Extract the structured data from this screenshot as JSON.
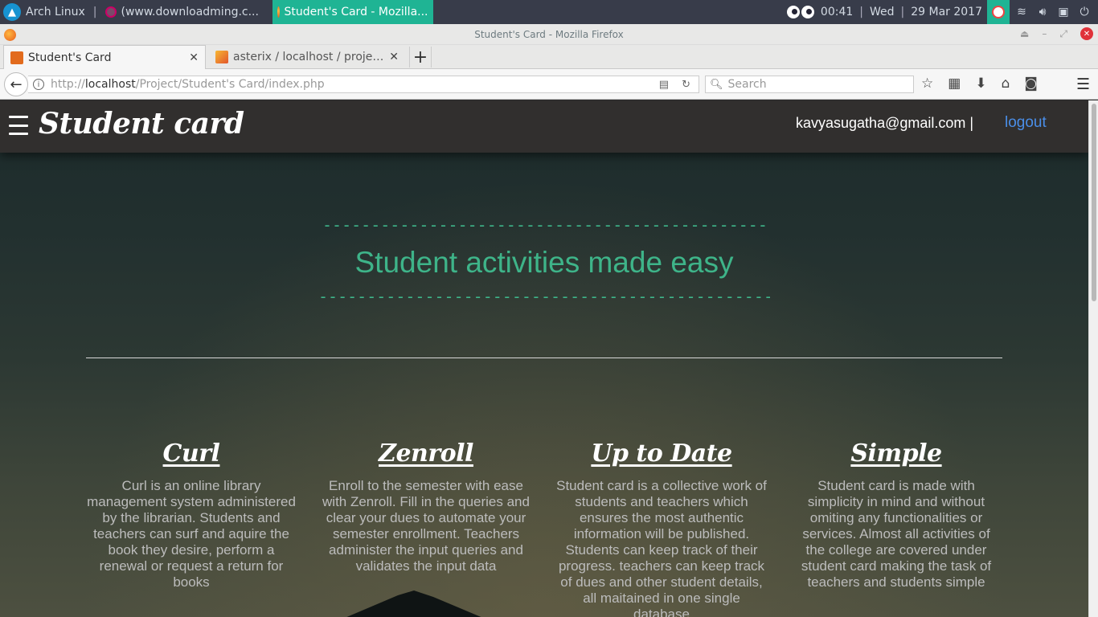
{
  "taskbar": {
    "os_label": "Arch Linux",
    "separator": "|",
    "tasks": [
      {
        "label": "(www.downloadming.c..."
      },
      {
        "label": "Student's Card - Mozilla..."
      }
    ],
    "time": "00:41",
    "day": "Wed",
    "date": "29 Mar 2017",
    "sep": "|"
  },
  "window": {
    "title": "Student's Card - Mozilla Firefox"
  },
  "tabs": [
    {
      "title": "Student's Card",
      "favicon_color": "#e26b1d"
    },
    {
      "title": "asterix / localhost / project ...",
      "favicon_color": "#f0a020"
    }
  ],
  "navbar": {
    "url_scheme": "http://",
    "url_host": "localhost",
    "url_path": "/Project/Student's Card/index.php",
    "search_placeholder": "Search"
  },
  "site": {
    "brand": "Student card",
    "user_email": "kavyasugatha@gmail.com |",
    "logout_label": "logout",
    "dash_top": "----------------------------------------------",
    "hero_title": "Student activities made easy",
    "dash_bottom": "-----------------------------------------------",
    "features": [
      {
        "title": "Curl",
        "text": "Curl is an online library management system administered by the librarian. Students and teachers can surf and aquire the book they desire, perform a renewal or request a return for books"
      },
      {
        "title": "Zenroll",
        "text": "Enroll to the semester with ease with Zenroll. Fill in the queries and clear your dues to automate your semester enrollment. Teachers administer the input queries and validates the input data"
      },
      {
        "title": "Up to Date",
        "text": "Student card is a collective work of students and teachers which ensures the most authentic information will be published. Students can keep track of their progress. teachers can keep track of dues and other student details, all maitained in one single database"
      },
      {
        "title": "Simple",
        "text": "Student card is made with simplicity in mind and without omiting any functionalities or services. Almost all activities of the college are covered under student card making the task of teachers and students simple"
      }
    ]
  },
  "colors": {
    "accent_green": "#3eb489",
    "link_blue": "#4a8ee8",
    "header_bg": "#312f2e",
    "taskbar_active": "#1fb494"
  }
}
